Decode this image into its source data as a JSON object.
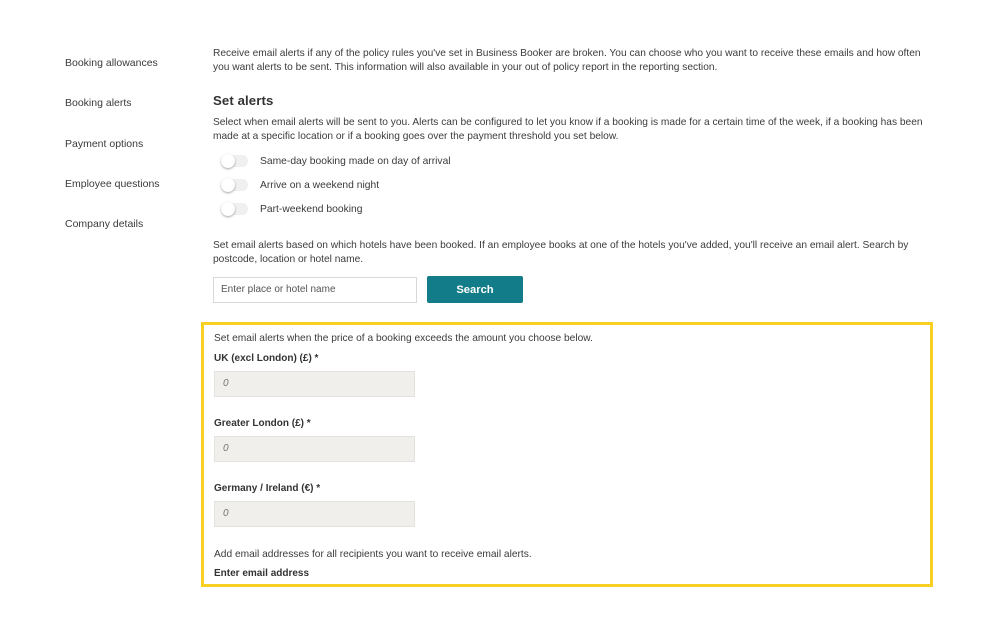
{
  "sidebar": {
    "items": [
      {
        "label": "Booking allowances"
      },
      {
        "label": "Booking alerts"
      },
      {
        "label": "Payment options"
      },
      {
        "label": "Employee questions"
      },
      {
        "label": "Company details"
      }
    ]
  },
  "main": {
    "intro": "Receive email alerts if any of the policy rules you've set in Business Booker are broken. You can choose who you want to receive these emails and how often you want alerts to be sent. This information will also available in your out of policy report in the reporting section.",
    "set_alerts_title": "Set alerts",
    "select_description": "Select when email alerts will be sent to you. Alerts can be configured to let you know if a booking is made for a certain time of the week, if a booking has been made at a specific location or if a booking goes over the payment threshold you set below.",
    "toggles": [
      {
        "label": "Same-day booking made on day of arrival",
        "on": false
      },
      {
        "label": "Arrive on a weekend night",
        "on": false
      },
      {
        "label": "Part-weekend booking",
        "on": false
      }
    ],
    "hotel_description": "Set email alerts based on which hotels have been booked. If an employee books at one of the hotels you've added, you'll receive an email alert. Search by postcode, location or hotel name.",
    "search": {
      "placeholder": "Enter place or hotel name",
      "value": "",
      "button_label": "Search"
    },
    "price_section": {
      "description": "Set email alerts when the price of a booking exceeds the amount you choose below.",
      "fields": [
        {
          "label": "UK (excl London) (£) *",
          "placeholder": "0"
        },
        {
          "label": "Greater London (£) *",
          "placeholder": "0"
        },
        {
          "label": "Germany / Ireland (€) *",
          "placeholder": "0"
        }
      ],
      "recipients_description": "Add email addresses for all recipients you want to receive email alerts.",
      "email_label": "Enter email address"
    }
  },
  "colors": {
    "accent_button": "#137c89",
    "highlight_border": "#f8cf23",
    "input_fill": "#f0efec"
  }
}
